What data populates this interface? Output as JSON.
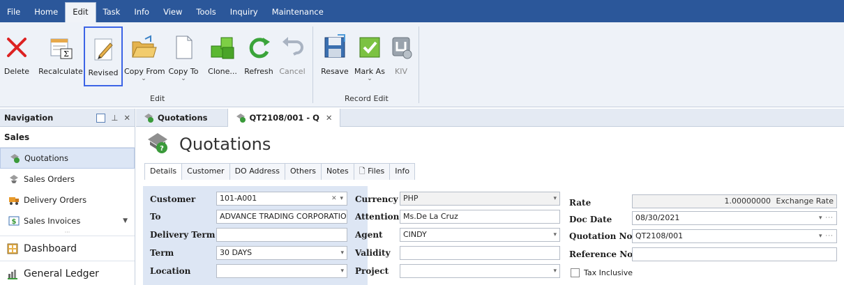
{
  "menu": {
    "items": [
      "File",
      "Home",
      "Edit",
      "Task",
      "Info",
      "View",
      "Tools",
      "Inquiry",
      "Maintenance"
    ],
    "active": "Edit"
  },
  "ribbon": {
    "edit_group_label": "Edit",
    "record_group_label": "Record Edit",
    "buttons": {
      "delete": "Delete",
      "recalculate": "Recalculate",
      "revised": "Revised",
      "copy_from": "Copy From",
      "copy_to": "Copy To",
      "clone": "Clone...",
      "refresh": "Refresh",
      "cancel": "Cancel",
      "resave": "Resave",
      "mark_as": "Mark As",
      "kiv": "KIV"
    },
    "selected_button": "revised"
  },
  "nav": {
    "title": "Navigation",
    "section": "Sales",
    "items": [
      "Quotations",
      "Sales Orders",
      "Delivery Orders",
      "Sales Invoices"
    ],
    "selected": "Quotations",
    "big_items": [
      "Dashboard",
      "General Ledger"
    ]
  },
  "doctabs": {
    "list_tab": "Quotations",
    "doc_tab": "QT2108/001 - Q"
  },
  "page": {
    "title": "Quotations"
  },
  "form_tabs": [
    "Details",
    "Customer",
    "DO Address",
    "Others",
    "Notes",
    "Files",
    "Info"
  ],
  "form": {
    "customer_label": "Customer",
    "customer_value": "101-A001",
    "to_label": "To",
    "to_value": "ADVANCE TRADING CORPORATIO",
    "delivery_term_label": "Delivery Term",
    "delivery_term_value": "",
    "term_label": "Term",
    "term_value": "30 DAYS",
    "location_label": "Location",
    "location_value": "",
    "currency_label": "Currency",
    "currency_value": "PHP",
    "attention_label": "Attention",
    "attention_value": "Ms.De La Cruz",
    "agent_label": "Agent",
    "agent_value": "CINDY",
    "validity_label": "Validity",
    "validity_value": "",
    "project_label": "Project",
    "project_value": "",
    "rate_label": "Rate",
    "rate_value": "1.00000000",
    "rate_suffix": "Exchange Rate",
    "doc_date_label": "Doc Date",
    "doc_date_value": "08/30/2021",
    "quotation_no_label": "Quotation No.",
    "quotation_no_value": "QT2108/001",
    "reference_no_label": "Reference No.",
    "reference_no_value": "",
    "tax_inclusive_label": "Tax Inclusive"
  }
}
